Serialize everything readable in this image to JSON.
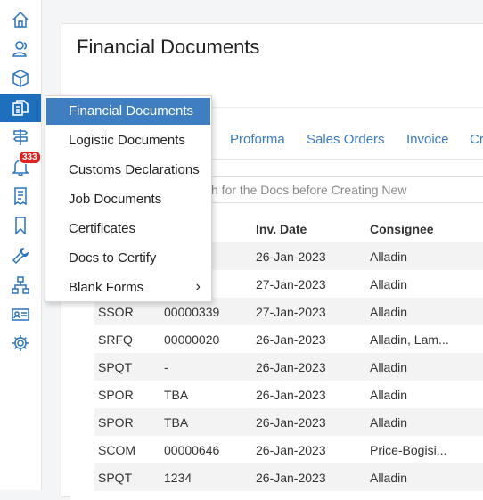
{
  "colors": {
    "accent": "#1f6fbf",
    "menu_active": "#3f7fc1",
    "tab_link": "#3a7cc4",
    "badge": "#e02020"
  },
  "sidebar": {
    "items": [
      {
        "name": "home-icon"
      },
      {
        "name": "users-icon"
      },
      {
        "name": "package-icon"
      },
      {
        "name": "documents-icon"
      },
      {
        "name": "signpost-icon"
      },
      {
        "name": "bell-icon",
        "badge": "333"
      },
      {
        "name": "receipt-icon"
      },
      {
        "name": "bookmark-icon"
      },
      {
        "name": "wrench-icon"
      },
      {
        "name": "hierarchy-icon"
      },
      {
        "name": "id-card-icon"
      },
      {
        "name": "gear-icon"
      }
    ]
  },
  "page": {
    "title": "Financial Documents"
  },
  "tabs": [
    "Proforma",
    "Sales Orders",
    "Invoice",
    "Cr"
  ],
  "search": {
    "placeholder": "h for the Docs before Creating New"
  },
  "table": {
    "headers": [
      "r",
      "Inv. Date",
      "Consignee"
    ],
    "rows": [
      [
        "",
        "2",
        "26-Jan-2023",
        "Alladin"
      ],
      [
        "",
        "3",
        "27-Jan-2023",
        "Alladin"
      ],
      [
        "SSOR",
        "00000339",
        "27-Jan-2023",
        "Alladin"
      ],
      [
        "SRFQ",
        "00000020",
        "26-Jan-2023",
        "Alladin, Lam..."
      ],
      [
        "SPQT",
        "-",
        "26-Jan-2023",
        "Alladin"
      ],
      [
        "SPOR",
        "TBA",
        "26-Jan-2023",
        "Alladin"
      ],
      [
        "SPOR",
        "TBA",
        "26-Jan-2023",
        "Alladin"
      ],
      [
        "SCOM",
        "00000646",
        "26-Jan-2023",
        "Price-Bogisi..."
      ],
      [
        "SPQT",
        "1234",
        "26-Jan-2023",
        "Alladin"
      ]
    ]
  },
  "menu": {
    "items": [
      {
        "label": "Financial Documents",
        "active": true
      },
      {
        "label": "Logistic Documents"
      },
      {
        "label": "Customs Declarations"
      },
      {
        "label": "Job Documents"
      },
      {
        "label": "Certificates"
      },
      {
        "label": "Docs to Certify"
      },
      {
        "label": "Blank Forms",
        "submenu_indicator": "›"
      }
    ]
  }
}
